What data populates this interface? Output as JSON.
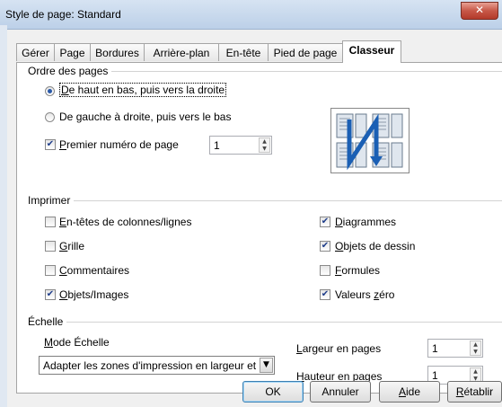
{
  "window": {
    "title": "Style de page: Standard",
    "close_glyph": "✕"
  },
  "tabs": [
    {
      "label": "Gérer",
      "active": false
    },
    {
      "label": "Page",
      "active": false
    },
    {
      "label": "Bordures",
      "active": false
    },
    {
      "label": "Arrière-plan",
      "active": false
    },
    {
      "label": "En-tête",
      "active": false
    },
    {
      "label": "Pied de page",
      "active": false
    },
    {
      "label": "Classeur",
      "active": true
    }
  ],
  "page_order": {
    "heading": "Ordre des pages",
    "option1": {
      "first": "D",
      "rest": "e haut en bas, puis vers la droite",
      "selected": true
    },
    "option2": {
      "pre": "De ",
      "accel": "g",
      "rest": "auche à droite, puis vers le bas",
      "selected": false
    },
    "first_page": {
      "accel": "P",
      "rest": "remier numéro de page",
      "checked": true,
      "value": "1"
    }
  },
  "print": {
    "heading": "Imprimer",
    "items_left": [
      {
        "accel": "E",
        "rest": "n-têtes de colonnes/lignes",
        "checked": false
      },
      {
        "accel": "G",
        "rest": "rille",
        "checked": false
      },
      {
        "accel": "C",
        "rest": "ommentaires",
        "checked": false
      },
      {
        "accel": "O",
        "rest": "bjets/Images",
        "checked": true
      }
    ],
    "items_right": [
      {
        "accel": "D",
        "rest": "iagrammes",
        "checked": true
      },
      {
        "accel": "O",
        "rest": "bjets de dessin",
        "checked": true
      },
      {
        "accel": "F",
        "rest": "ormules",
        "checked": false
      },
      {
        "pre": "Valeurs ",
        "accel": "z",
        "rest": "éro",
        "checked": true
      }
    ]
  },
  "scale": {
    "heading": "Échelle",
    "mode_label_accel": "M",
    "mode_label_rest": "ode Échelle",
    "mode_value": "Adapter les zones d'impression en largeur et",
    "width_label_accel": "L",
    "width_label_rest": "argeur en pages",
    "width_value": "1",
    "height_label_accel": "H",
    "height_label_rest": "auteur en pages",
    "height_value": "1"
  },
  "buttons": {
    "ok": "OK",
    "cancel": "Annuler",
    "help_accel": "A",
    "help_rest": "ide",
    "reset_accel": "R",
    "reset_rest": "établir"
  },
  "colors": {
    "accent": "#2a59a8",
    "preview_arrow": "#1a5fb4"
  }
}
